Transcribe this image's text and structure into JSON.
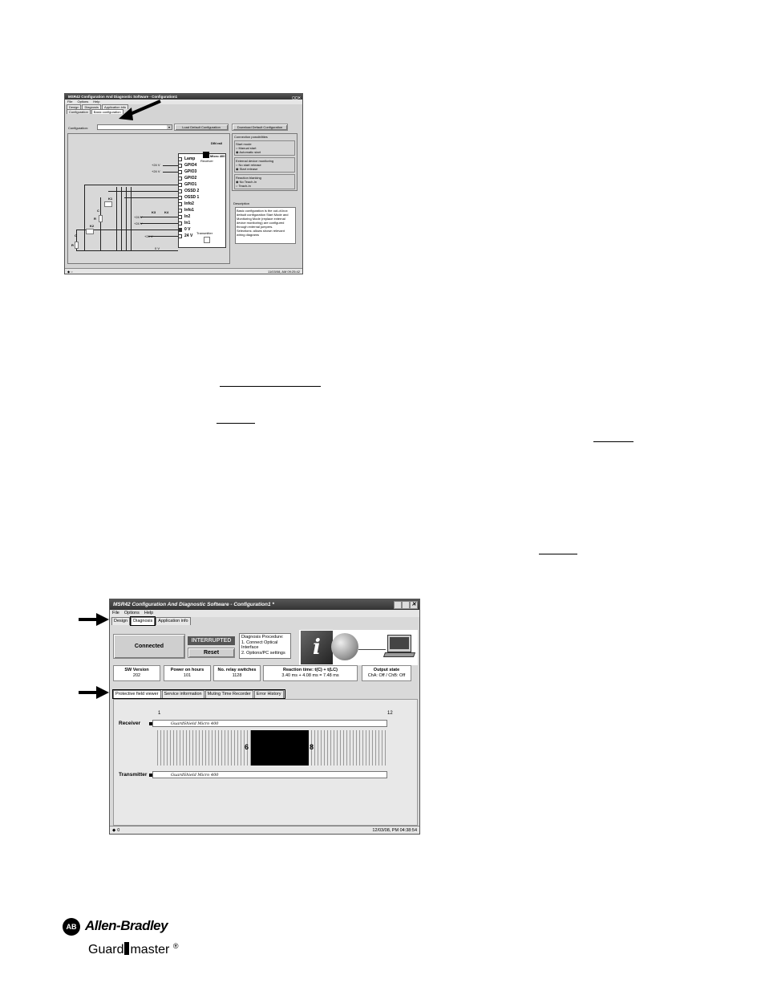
{
  "top_window": {
    "title": "MSR42 Configuration And Diagnostic Software - Configuration1",
    "menu": [
      "File",
      "Options",
      "Help"
    ],
    "tabs": [
      "Design",
      "Diagnosis",
      "Application info"
    ],
    "subtabs": [
      "Configuration",
      "Basic configuration"
    ],
    "config_label": "Configuration:",
    "load_button": "Load Default Configuration",
    "download_button": "Download Default Configuration",
    "din_rail": "DIN rail",
    "micro": "Micro 400",
    "receiver": "Receiver",
    "transmitter": "Transmitter",
    "pins": [
      "Lamp",
      "GPIO4",
      "GPIO3",
      "GPIO2",
      "GPIO1",
      "OSSD 2",
      "OSSD 1",
      "Info2",
      "Info1",
      "In2",
      "In1",
      "0 V",
      "24 V"
    ],
    "wire_labels": {
      "v24a": "+24 V",
      "v24b": "+24 V",
      "v24c": "+24 V",
      "v24d": "+24 V",
      "v24e": "+24 V",
      "k1": "K1",
      "k2": "K2",
      "k3": "K3",
      "k4": "K4",
      "c1": "C",
      "c2": "C",
      "r1": "R",
      "r2": "R",
      "zero": "0 V"
    },
    "groups": [
      {
        "title": "Connection possibilities",
        "items": []
      },
      {
        "title": "Start mode",
        "items": [
          "Manual start",
          "Automatic start"
        ]
      },
      {
        "title": "External device monitoring",
        "items": [
          "No start release",
          "Start release"
        ]
      },
      {
        "title": "Reaction blanking",
        "items": [
          "No Teach-In",
          "Teach-In"
        ]
      }
    ],
    "description_label": "Description",
    "description_text": "Basic configuration is the out-of-box default configuration Start Mode and Monitoring Mode (replace external device monitoring) are configured through external jumpers. Selections: allows shown relevant wiring diagrams",
    "status_right": "11/03/08, AM 09:25:42"
  },
  "bottom_window": {
    "title": "MSR42 Configuration And Diagnostic Software - Configuration1 *",
    "menu": [
      "File",
      "Options",
      "Help"
    ],
    "tabs": [
      "Design",
      "Diagnosis",
      "Application info"
    ],
    "connected": "Connected",
    "interrupted": "INTERRUPTED",
    "reset": "Reset",
    "procedure": {
      "title": "Diagnosis Procedure:",
      "step1": "1. Connect Optical Interface",
      "step2": "2. Options/PC settings"
    },
    "stats": [
      {
        "label": "SW Version",
        "value": "202"
      },
      {
        "label": "Power on hours",
        "value": "101"
      },
      {
        "label": "No. relay switches",
        "value": "1128"
      },
      {
        "label": "Reaction time: t(C) + t(LC)",
        "value": "3.40 ms + 4.08 ms = 7.48 ms"
      },
      {
        "label": "Output state",
        "value": "ChA: Off / ChB: Off"
      }
    ],
    "subtabs": [
      "Protective field viewer",
      "Service information",
      "Muting Time Recorder",
      "Error History"
    ],
    "scale_start": "1",
    "scale_end": "12",
    "receiver_label": "Receiver",
    "transmitter_label": "Transmitter",
    "bar_text": "GuardShield Micro 400",
    "blocked_start": "6",
    "blocked_end": "8",
    "status_right": "12/03/08, PM 04:38:54",
    "status_left": "0"
  },
  "logo": {
    "badge": "AB",
    "brand": "Allen-Bradley",
    "sub1": "Guard",
    "sub2": "master",
    "reg": "®"
  }
}
